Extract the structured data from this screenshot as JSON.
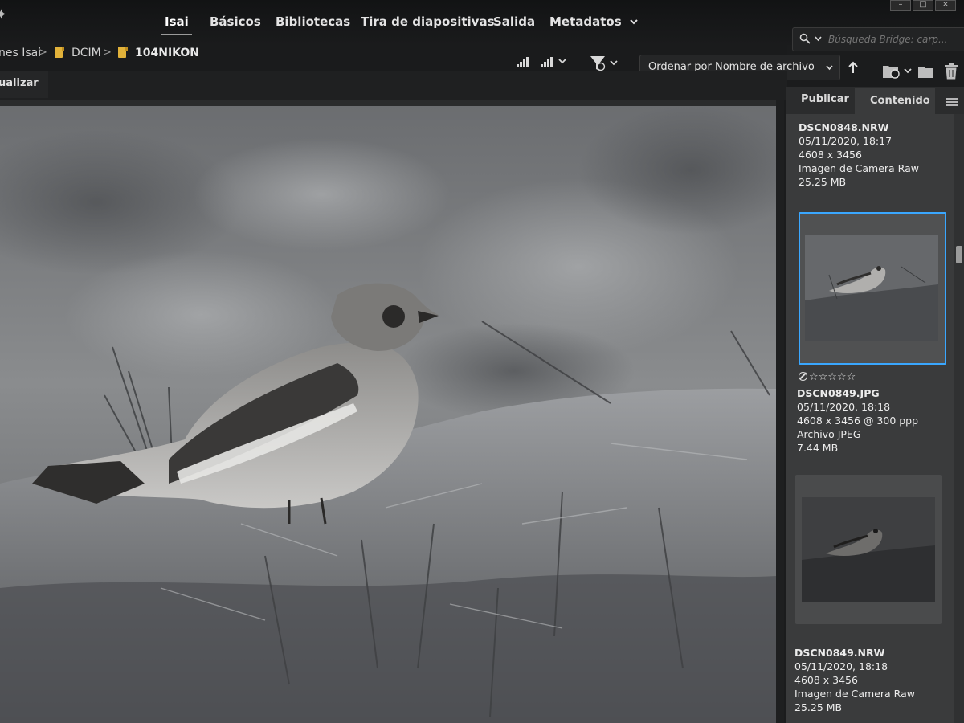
{
  "menu": {
    "tabs": [
      {
        "label": "Isai",
        "active": true
      },
      {
        "label": "Básicos"
      },
      {
        "label": "Bibliotecas"
      },
      {
        "label": "Tira de diapositivas"
      },
      {
        "label": "Salida"
      },
      {
        "label": "Metadatos"
      }
    ],
    "more_icon": "chevron-down-icon"
  },
  "search": {
    "placeholder": "Búsqueda Bridge: carp..."
  },
  "path": {
    "crumbs": [
      {
        "label": "nes Isai"
      },
      {
        "label": "DCIM"
      },
      {
        "label": "104NIKON"
      }
    ],
    "separator": ">"
  },
  "toolbar": {
    "sort_label": "Ordenar por Nombre de archivo",
    "icons": [
      "quality-icon",
      "quality-dropdown-icon",
      "filter-icon",
      "sort-ascending-icon",
      "recent-folder-icon",
      "new-folder-icon",
      "trash-icon"
    ]
  },
  "left_panel": {
    "tab_label": "ualizar"
  },
  "right_panel": {
    "tabs": [
      {
        "label": "Publicar"
      },
      {
        "label": "Contenido",
        "active": true
      }
    ],
    "items": [
      {
        "filename": "DSCN0848.NRW",
        "date": "05/11/2020, 18:17",
        "dimensions": "4608 x 3456",
        "type": "Imagen de Camera Raw",
        "size": "25.25 MB"
      },
      {
        "filename": "DSCN0849.JPG",
        "date": "05/11/2020, 18:18",
        "dimensions": "4608 x 3456 @ 300 ppp",
        "type": "Archivo JPEG",
        "size": "7.44 MB",
        "selected": true,
        "rating": 0,
        "stars": "☆☆☆☆☆"
      },
      {
        "filename": "DSCN0849.NRW",
        "date": "05/11/2020, 18:18",
        "dimensions": "4608 x 3456",
        "type": "Imagen de Camera Raw",
        "size": "25.25 MB"
      }
    ]
  },
  "colors": {
    "selection": "#3aa7ff",
    "folder": "#e2b23a"
  }
}
